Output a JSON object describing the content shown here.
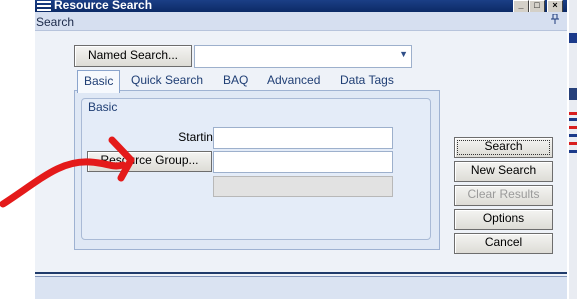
{
  "window": {
    "title": "Resource Search",
    "panel_title": "Search",
    "pin_icon": "pushpin-icon",
    "controls": [
      "_",
      "□",
      "×"
    ]
  },
  "named_search": {
    "button_label": "Named Search...",
    "value": ""
  },
  "tabs": [
    {
      "label": "Basic",
      "active": true
    },
    {
      "label": "Quick Search",
      "active": false
    },
    {
      "label": "BAQ",
      "active": false
    },
    {
      "label": "Advanced",
      "active": false
    },
    {
      "label": "Data Tags",
      "active": false
    }
  ],
  "basic": {
    "group_label": "Basic",
    "starting_at_label": "Starting At:",
    "starting_at_value": "",
    "resource_group_button": "Resource Group...",
    "resource_group_value": "",
    "description_value": ""
  },
  "actions": {
    "search": "Search",
    "new_search": "New Search",
    "clear_results": "Clear Results",
    "options": "Options",
    "cancel": "Cancel"
  },
  "annotation": {
    "color": "#e41a1a"
  }
}
